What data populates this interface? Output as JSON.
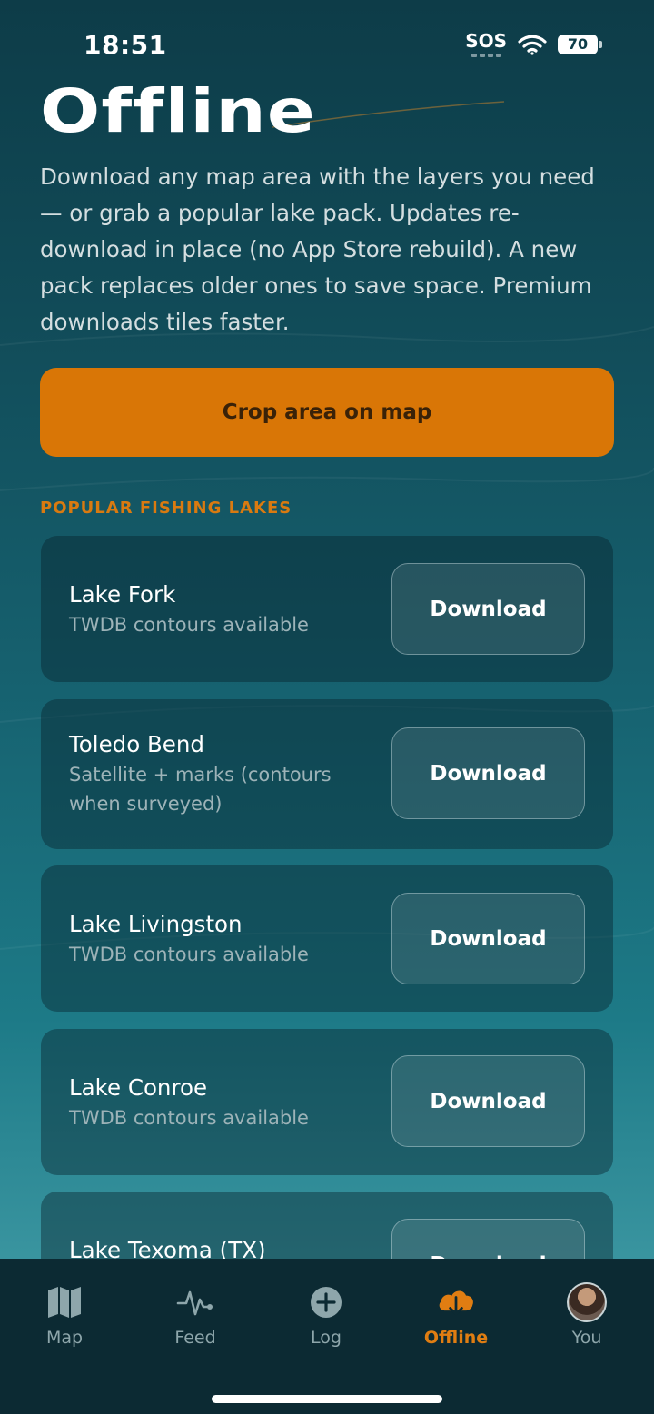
{
  "status_bar": {
    "time": "18:51",
    "sos": "SOS",
    "battery": "70"
  },
  "header": {
    "title": "Offline",
    "description": "Download any map area with the layers you need — or grab a popular lake pack. Updates re-download in place (no App Store rebuild). A new pack replaces older ones to save space. Premium downloads tiles faster."
  },
  "crop_button_label": "Crop area on map",
  "section_label": "POPULAR FISHING LAKES",
  "lakes": [
    {
      "name": "Lake Fork",
      "subtitle": "TWDB contours available",
      "button_label": "Download"
    },
    {
      "name": "Toledo Bend",
      "subtitle": "Satellite + marks (contours when surveyed)",
      "button_label": "Download"
    },
    {
      "name": "Lake Livingston",
      "subtitle": "TWDB contours available",
      "button_label": "Download"
    },
    {
      "name": "Lake Conroe",
      "subtitle": "TWDB contours available",
      "button_label": "Download"
    },
    {
      "name": "Lake Texoma (TX)",
      "subtitle": "",
      "button_label": "Download"
    }
  ],
  "tab_bar": {
    "active_tab": "Offline",
    "tabs": [
      {
        "label": "Map",
        "icon": "map-icon"
      },
      {
        "label": "Feed",
        "icon": "activity-icon"
      },
      {
        "label": "Log",
        "icon": "plus-circle-icon"
      },
      {
        "label": "Offline",
        "icon": "cloud-download-icon"
      },
      {
        "label": "You",
        "icon": "avatar"
      }
    ]
  },
  "colors": {
    "accent": "#d97606",
    "background_top": "#0d3c48",
    "background_bottom": "#4ea2ab",
    "tab_bar": "#0c2a33"
  }
}
